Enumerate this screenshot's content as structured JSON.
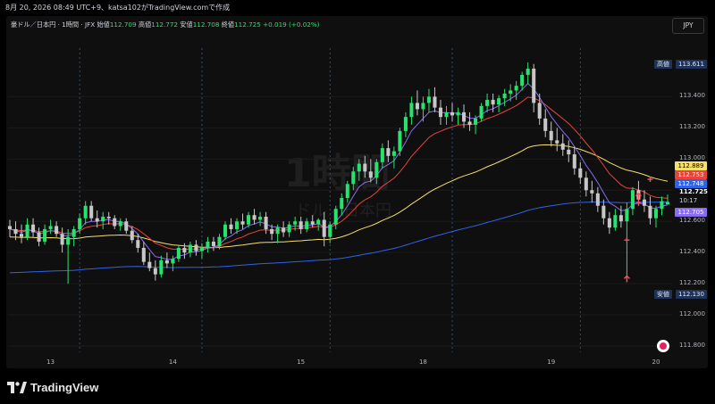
{
  "header": {
    "timestamp": "8月 20, 2026 08:49 UTC+9、katsa102がTradingView.comで作成"
  },
  "legend": {
    "symbol": "豪ドル／日本円 · 1時間 · JFX",
    "open_label": "始値",
    "open": "112.709",
    "high_label": "高値",
    "high": "112.772",
    "low_label": "安値",
    "low": "112.708",
    "close_label": "終値",
    "close": "112.725",
    "change": "+0.019 (+0.02%)"
  },
  "currency_button": "JPY",
  "watermark": {
    "main": "1時間",
    "sub": "ドル／日本円"
  },
  "colors": {
    "up": "#26e36d",
    "down": "#c7c7c7",
    "ema_fast": "#8a6cf0",
    "ema_mid": "#e8433b",
    "ema_slow": "#f6e06a",
    "ema_long": "#2f64e6",
    "arrow": "#ff4d5e",
    "grid": "#1b1b1b",
    "vline": "#2d5f99"
  },
  "price_axis": {
    "ticks": [
      "113.400",
      "113.200",
      "113.000",
      "112.600",
      "112.400",
      "112.200",
      "112.000",
      "111.800"
    ],
    "high_label": "高値",
    "high_value": "113.611",
    "low_label": "安値",
    "low_value": "112.130",
    "tags": [
      {
        "value": "112.889",
        "color": "#f6e06a",
        "text_color": "#000"
      },
      {
        "value": "112.753",
        "color": "#e8433b",
        "text_color": "#fff"
      },
      {
        "value": "112.748",
        "color": "#2f64e6",
        "text_color": "#fff"
      },
      {
        "value": "112.705",
        "color": "#8a6cf0",
        "text_color": "#fff"
      }
    ],
    "last_price": "112.725",
    "countdown": "10:17"
  },
  "time_axis": {
    "labels": [
      "13",
      "14",
      "15",
      "18",
      "19",
      "20"
    ]
  },
  "chart_data": {
    "type": "candlestick",
    "interval": "1h",
    "candles": [
      [
        112.57,
        112.61,
        112.5,
        112.55
      ],
      [
        112.55,
        112.6,
        112.48,
        112.52
      ],
      [
        112.52,
        112.58,
        112.46,
        112.5
      ],
      [
        112.5,
        112.62,
        112.48,
        112.58
      ],
      [
        112.58,
        112.62,
        112.5,
        112.53
      ],
      [
        112.53,
        112.56,
        112.44,
        112.47
      ],
      [
        112.47,
        112.58,
        112.45,
        112.55
      ],
      [
        112.55,
        112.61,
        112.52,
        112.57
      ],
      [
        112.57,
        112.6,
        112.5,
        112.52
      ],
      [
        112.52,
        112.56,
        112.4,
        112.45
      ],
      [
        112.45,
        112.55,
        112.2,
        112.5
      ],
      [
        112.5,
        112.57,
        112.44,
        112.55
      ],
      [
        112.55,
        112.65,
        112.52,
        112.62
      ],
      [
        112.62,
        112.73,
        112.58,
        112.7
      ],
      [
        112.7,
        112.73,
        112.6,
        112.62
      ],
      [
        112.62,
        112.67,
        112.56,
        112.6
      ],
      [
        112.6,
        112.66,
        112.55,
        112.63
      ],
      [
        112.63,
        112.66,
        112.58,
        112.62
      ],
      [
        112.62,
        112.64,
        112.55,
        112.57
      ],
      [
        112.57,
        112.62,
        112.54,
        112.6
      ],
      [
        112.6,
        112.62,
        112.52,
        112.54
      ],
      [
        112.54,
        112.57,
        112.46,
        112.48
      ],
      [
        112.48,
        112.52,
        112.4,
        112.43
      ],
      [
        112.43,
        112.47,
        112.32,
        112.34
      ],
      [
        112.34,
        112.4,
        112.28,
        112.3
      ],
      [
        112.3,
        112.35,
        112.22,
        112.26
      ],
      [
        112.26,
        112.38,
        112.24,
        112.35
      ],
      [
        112.35,
        112.4,
        112.3,
        112.33
      ],
      [
        112.33,
        112.38,
        112.28,
        112.36
      ],
      [
        112.36,
        112.45,
        112.34,
        112.43
      ],
      [
        112.43,
        112.46,
        112.36,
        112.4
      ],
      [
        112.4,
        112.47,
        112.37,
        112.45
      ],
      [
        112.45,
        112.48,
        112.38,
        112.41
      ],
      [
        112.41,
        112.46,
        112.36,
        112.43
      ],
      [
        112.43,
        112.5,
        112.4,
        112.47
      ],
      [
        112.47,
        112.5,
        112.41,
        112.44
      ],
      [
        112.44,
        112.52,
        112.42,
        112.5
      ],
      [
        112.5,
        112.6,
        112.48,
        112.58
      ],
      [
        112.58,
        112.62,
        112.52,
        112.55
      ],
      [
        112.55,
        112.62,
        112.52,
        112.6
      ],
      [
        112.6,
        112.65,
        112.55,
        112.58
      ],
      [
        112.58,
        112.66,
        112.56,
        112.64
      ],
      [
        112.64,
        112.68,
        112.58,
        112.61
      ],
      [
        112.61,
        112.66,
        112.57,
        112.63
      ],
      [
        112.63,
        112.66,
        112.52,
        112.55
      ],
      [
        112.55,
        112.58,
        112.48,
        112.52
      ],
      [
        112.52,
        112.58,
        112.46,
        112.56
      ],
      [
        112.56,
        112.6,
        112.5,
        112.53
      ],
      [
        112.53,
        112.6,
        112.5,
        112.58
      ],
      [
        112.58,
        112.63,
        112.54,
        112.6
      ],
      [
        112.6,
        112.63,
        112.52,
        112.55
      ],
      [
        112.55,
        112.62,
        112.53,
        112.6
      ],
      [
        112.6,
        112.64,
        112.56,
        112.58
      ],
      [
        112.58,
        112.62,
        112.54,
        112.61
      ],
      [
        112.61,
        112.66,
        112.44,
        112.5
      ],
      [
        112.5,
        112.6,
        112.46,
        112.58
      ],
      [
        112.58,
        112.7,
        112.55,
        112.68
      ],
      [
        112.68,
        112.78,
        112.64,
        112.75
      ],
      [
        112.75,
        112.86,
        112.72,
        112.84
      ],
      [
        112.84,
        112.95,
        112.8,
        112.92
      ],
      [
        112.92,
        113.0,
        112.86,
        112.97
      ],
      [
        112.97,
        113.02,
        112.88,
        112.92
      ],
      [
        112.92,
        113.0,
        112.85,
        112.88
      ],
      [
        112.88,
        113.0,
        112.84,
        112.98
      ],
      [
        112.98,
        113.1,
        112.94,
        113.07
      ],
      [
        113.07,
        113.12,
        112.98,
        113.02
      ],
      [
        113.02,
        113.08,
        112.94,
        113.05
      ],
      [
        113.05,
        113.2,
        113.02,
        113.18
      ],
      [
        113.18,
        113.3,
        113.14,
        113.27
      ],
      [
        113.27,
        113.4,
        113.22,
        113.36
      ],
      [
        113.36,
        113.44,
        113.28,
        113.32
      ],
      [
        113.32,
        113.4,
        113.24,
        113.36
      ],
      [
        113.36,
        113.45,
        113.3,
        113.4
      ],
      [
        113.4,
        113.46,
        113.3,
        113.33
      ],
      [
        113.33,
        113.38,
        113.22,
        113.27
      ],
      [
        113.27,
        113.34,
        113.22,
        113.3
      ],
      [
        113.3,
        113.36,
        113.24,
        113.28
      ],
      [
        113.28,
        113.33,
        113.22,
        113.3
      ],
      [
        113.3,
        113.35,
        113.2,
        113.24
      ],
      [
        113.24,
        113.3,
        113.18,
        113.22
      ],
      [
        113.22,
        113.28,
        113.16,
        113.26
      ],
      [
        113.26,
        113.36,
        113.24,
        113.34
      ],
      [
        113.34,
        113.42,
        113.3,
        113.38
      ],
      [
        113.38,
        113.42,
        113.3,
        113.35
      ],
      [
        113.35,
        113.41,
        113.3,
        113.39
      ],
      [
        113.39,
        113.45,
        113.34,
        113.42
      ],
      [
        113.42,
        113.48,
        113.37,
        113.44
      ],
      [
        113.44,
        113.5,
        113.38,
        113.47
      ],
      [
        113.47,
        113.56,
        113.44,
        113.54
      ],
      [
        113.54,
        113.62,
        113.48,
        113.58
      ],
      [
        113.58,
        113.61,
        113.3,
        113.36
      ],
      [
        113.36,
        113.42,
        113.22,
        113.26
      ],
      [
        113.26,
        113.32,
        113.14,
        113.18
      ],
      [
        113.18,
        113.24,
        113.08,
        113.12
      ],
      [
        113.12,
        113.2,
        113.05,
        113.1
      ],
      [
        113.1,
        113.16,
        113.02,
        113.06
      ],
      [
        113.06,
        113.12,
        112.98,
        113.03
      ],
      [
        113.03,
        113.08,
        112.9,
        112.94
      ],
      [
        112.94,
        112.98,
        112.84,
        112.88
      ],
      [
        112.88,
        112.92,
        112.76,
        112.8
      ],
      [
        112.8,
        112.86,
        112.72,
        112.78
      ],
      [
        112.78,
        112.82,
        112.66,
        112.7
      ],
      [
        112.7,
        112.74,
        112.58,
        112.62
      ],
      [
        112.62,
        112.66,
        112.52,
        112.56
      ],
      [
        112.56,
        112.68,
        112.54,
        112.64
      ],
      [
        112.64,
        112.7,
        112.56,
        112.6
      ],
      [
        112.6,
        112.72,
        112.22,
        112.68
      ],
      [
        112.68,
        112.82,
        112.64,
        112.8
      ],
      [
        112.8,
        112.86,
        112.7,
        112.74
      ],
      [
        112.74,
        112.8,
        112.66,
        112.7
      ],
      [
        112.7,
        112.76,
        112.58,
        112.62
      ],
      [
        112.62,
        112.7,
        112.56,
        112.68
      ],
      [
        112.68,
        112.76,
        112.64,
        112.73
      ],
      [
        112.709,
        112.772,
        112.708,
        112.725
      ]
    ],
    "series": [
      {
        "name": "ema_fast"
      },
      {
        "name": "ema_mid"
      },
      {
        "name": "ema_slow"
      },
      {
        "name": "ema_long"
      }
    ],
    "ylim": [
      111.76,
      113.7
    ]
  }
}
